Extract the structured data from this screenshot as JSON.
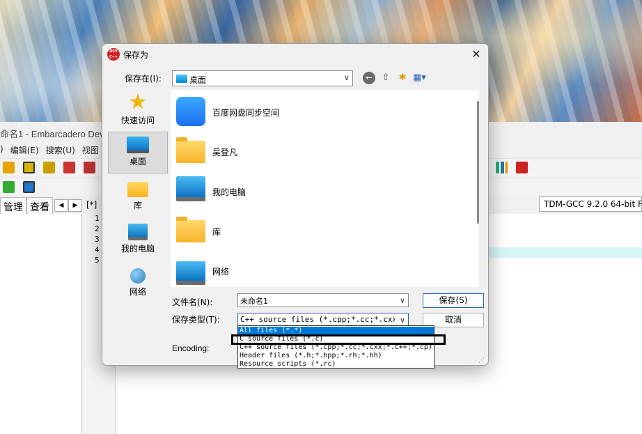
{
  "ide": {
    "title": "命名1 - Embarcadero Dev",
    "menu": [
      ") ",
      "编辑(E)",
      "搜索(U)",
      "视图"
    ],
    "compiler": "TDM-GCC 9.2.0 64-bit Re",
    "tabs": [
      "管理",
      "查看"
    ],
    "editor_tab": "[*] ",
    "line_numbers": [
      "1",
      "2",
      "3",
      "4",
      "5"
    ]
  },
  "dialog": {
    "title": "保存为",
    "save_in_label": "保存在(I):",
    "save_in_value": "桌面",
    "places": [
      {
        "label": "快速访问",
        "icon": "quick-access-icon"
      },
      {
        "label": "桌面",
        "icon": "desktop-icon"
      },
      {
        "label": "库",
        "icon": "library-icon"
      },
      {
        "label": "我的电脑",
        "icon": "my-computer-icon"
      },
      {
        "label": "网络",
        "icon": "network-icon"
      }
    ],
    "files": [
      {
        "label": "百度网盘同步空间",
        "icon": "baidu-netdisk-icon"
      },
      {
        "label": "吴登凡",
        "icon": "folder-icon"
      },
      {
        "label": "我的电脑",
        "icon": "computer-icon"
      },
      {
        "label": "库",
        "icon": "folder-icon"
      },
      {
        "label": "网络",
        "icon": "network-icon"
      }
    ],
    "filename_label": "文件名(N):",
    "filename_value": "未命名1",
    "filetype_label": "保存类型(T):",
    "filetype_value": "C++ source files (*.cpp;*.cc;*.cxx;*.",
    "encoding_label": "Encoding:",
    "save_button": "保存(S)",
    "cancel_button": "取消",
    "close_glyph": "✕",
    "app_icon_text": "DEV C++"
  },
  "dropdown": {
    "options": [
      "All files (*.*)",
      "C source files (*.c)",
      "C++ source files (*.cpp;*.cc;*.cxx;*.c++;*.cp)",
      "Header files (*.h;*.hpp;*.rh;*.hh)",
      "Resource scripts (*.rc)"
    ],
    "selected_index": 0,
    "highlighted_by_annotation": "C source files (*.c)"
  },
  "colors": {
    "selection": "#0078d7",
    "accent_border": "#2a64b8",
    "editor_highlight": "#d6f6f8"
  }
}
